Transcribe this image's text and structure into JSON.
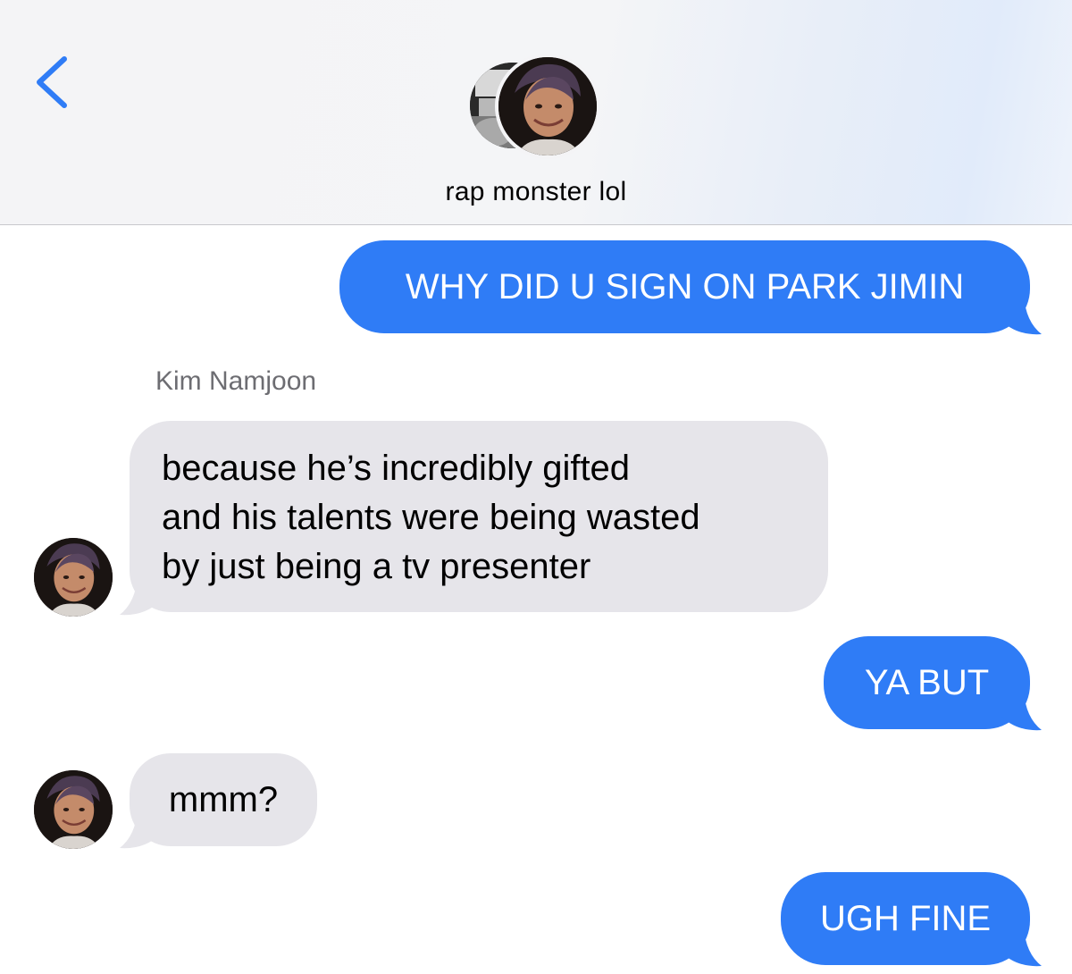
{
  "header": {
    "contact_name": "rap monster lol",
    "back_icon": "chevron-left-icon",
    "accent_color": "#2f7cf6"
  },
  "messages": [
    {
      "direction": "sent",
      "text": "WHY DID U SIGN ON PARK JIMIN"
    },
    {
      "direction": "received",
      "sender": "Kim Namjoon",
      "lines": [
        "because he’s incredibly gifted",
        "and his talents were being wasted",
        "by just being a tv presenter"
      ]
    },
    {
      "direction": "sent",
      "text": "YA BUT"
    },
    {
      "direction": "received",
      "text": "mmm?"
    },
    {
      "direction": "sent",
      "text": "UGH FINE"
    }
  ],
  "colors": {
    "sent_bubble": "#2f7cf6",
    "received_bubble": "#e6e5ea"
  }
}
